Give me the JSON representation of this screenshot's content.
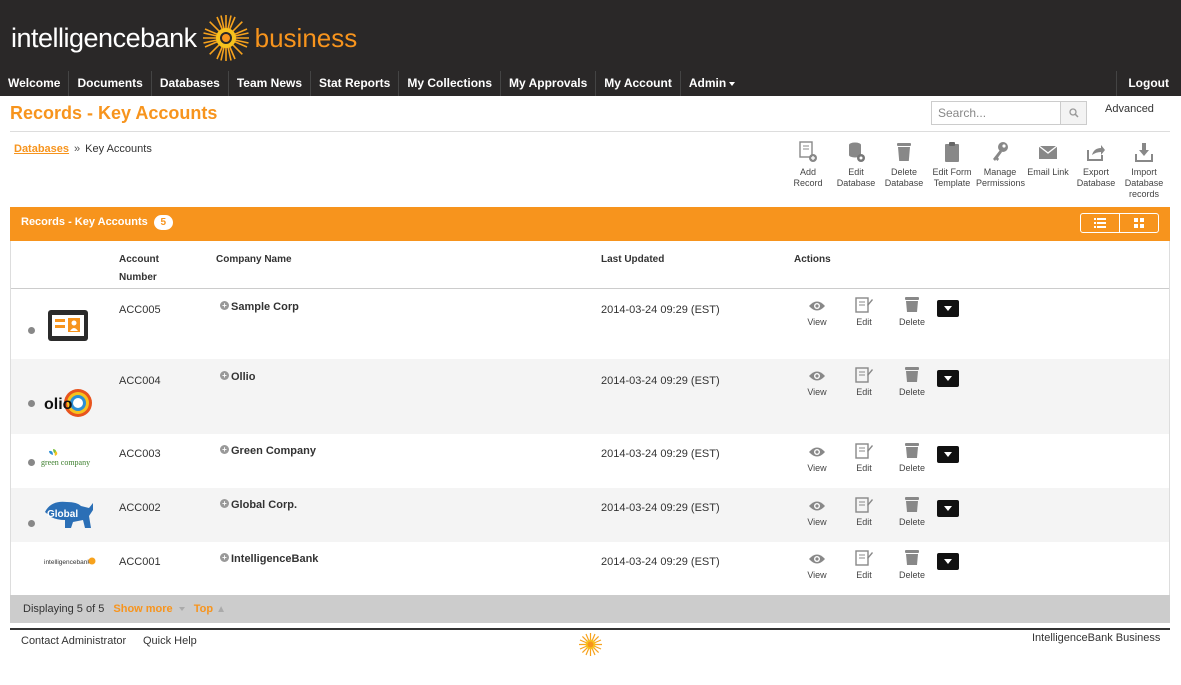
{
  "brand": {
    "name_left": "intelligencebank",
    "name_right": "business",
    "accent": "#f7941d"
  },
  "nav": {
    "items": [
      "Welcome",
      "Documents",
      "Databases",
      "Team News",
      "Stat Reports",
      "My Collections",
      "My Approvals",
      "My Account",
      "Admin"
    ],
    "logout": "Logout"
  },
  "page": {
    "title": "Records - Key Accounts"
  },
  "search": {
    "placeholder": "Search...",
    "advanced": "Advanced"
  },
  "breadcrumb": {
    "parent": "Databases",
    "separator": "»",
    "current": "Key Accounts"
  },
  "toolbar": [
    {
      "label": "Add Record",
      "icon": "add-record-icon"
    },
    {
      "label": "Edit Database",
      "icon": "edit-database-icon"
    },
    {
      "label": "Delete Database",
      "icon": "trash-icon"
    },
    {
      "label": "Edit Form Template",
      "icon": "clipboard-icon"
    },
    {
      "label": "Manage Permissions",
      "icon": "key-icon"
    },
    {
      "label": "Email Link",
      "icon": "envelope-icon"
    },
    {
      "label": "Export Database",
      "icon": "export-icon"
    },
    {
      "label": "Import Database records",
      "icon": "import-icon"
    }
  ],
  "panel": {
    "title": "Records - Key Accounts",
    "count": "5"
  },
  "table": {
    "headers": {
      "account_line1": "Account",
      "account_line2": "Number",
      "company": "Company Name",
      "updated": "Last Updated",
      "actions": "Actions"
    },
    "action_labels": {
      "view": "View",
      "edit": "Edit",
      "delete": "Delete"
    },
    "rows": [
      {
        "account": "ACC005",
        "company": "Sample Corp",
        "updated": "2014-03-24 09:29 (EST)",
        "logo": "id-card-icon"
      },
      {
        "account": "ACC004",
        "company": "Ollio",
        "updated": "2014-03-24 09:29 (EST)",
        "logo": "olio-logo",
        "logo_text": "olio"
      },
      {
        "account": "ACC003",
        "company": "Green Company",
        "updated": "2014-03-24 09:29 (EST)",
        "logo": "green-company-logo",
        "logo_text": "green company"
      },
      {
        "account": "ACC002",
        "company": "Global Corp.",
        "updated": "2014-03-24 09:29 (EST)",
        "logo": "global-rhino-logo",
        "logo_text": "Global"
      },
      {
        "account": "ACC001",
        "company": "IntelligenceBank",
        "updated": "2014-03-24 09:29 (EST)",
        "logo": "intelligencebank-logo",
        "logo_text": "intelligencebank"
      }
    ]
  },
  "footer": {
    "displaying": "Displaying 5 of 5",
    "show_more": "Show more",
    "top": "Top",
    "contact": "Contact Administrator",
    "help": "Quick Help",
    "brand": "IntelligenceBank Business"
  }
}
